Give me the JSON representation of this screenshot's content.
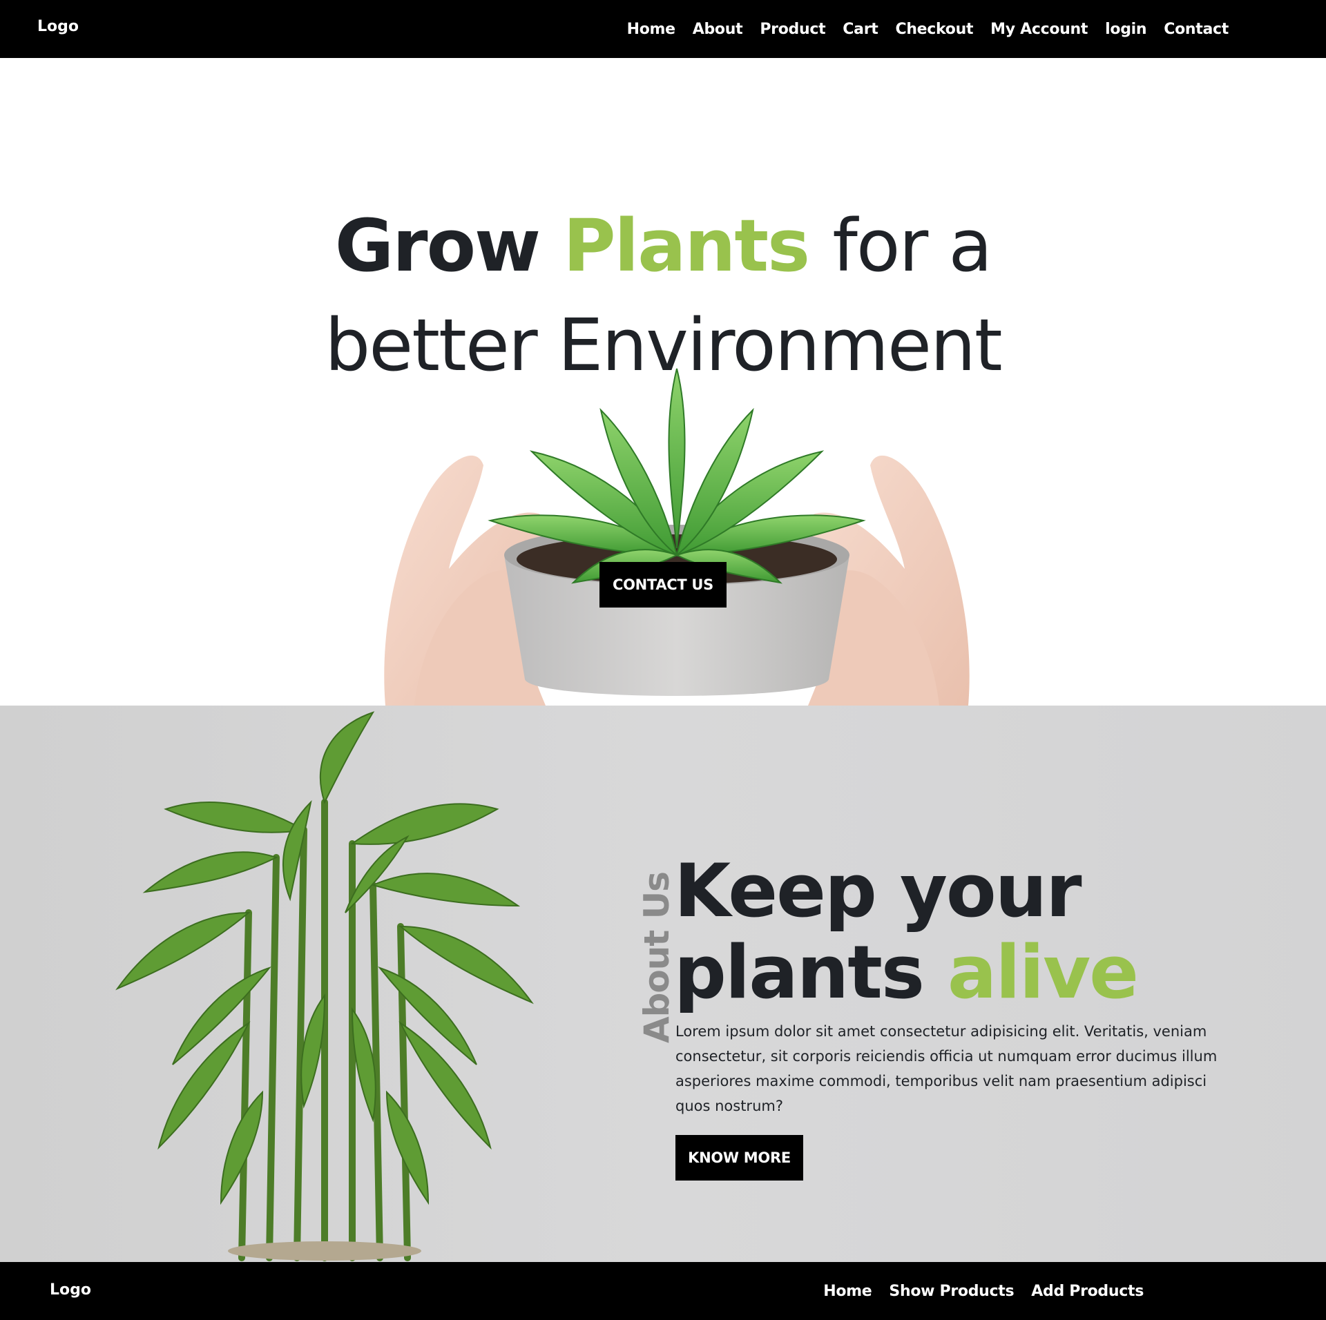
{
  "header": {
    "logo": "Logo",
    "nav": [
      "Home",
      "About",
      "Product",
      "Cart",
      "Checkout",
      "My Account",
      "login",
      "Contact"
    ]
  },
  "hero": {
    "title_word1": "Grow",
    "title_word2": "Plants",
    "title_word3": "for a",
    "title_line2": "better Environment",
    "button": "CONTACT US"
  },
  "about": {
    "side_label": "About Us",
    "title_line1": "Keep your",
    "title_word2": "plants",
    "title_word3": "alive",
    "body": "Lorem ipsum dolor sit amet consectetur adipisicing elit. Veritatis, veniam consectetur, sit corporis reiciendis officia ut numquam error ducimus illum asperiores maxime commodi, temporibus velit nam praesentium adipisci quos nostrum?",
    "button": "KNOW MORE"
  },
  "footer": {
    "logo": "Logo",
    "nav": [
      "Home",
      "Show Products",
      "Add Products"
    ]
  },
  "colors": {
    "accent": "#99c24d",
    "dark": "#1f2227",
    "nav_bg": "#000000",
    "about_bg": "#d6d6d7"
  },
  "images": {
    "hero": "succulent-in-hands-image",
    "about": "lucky-bamboo-plant-image"
  }
}
